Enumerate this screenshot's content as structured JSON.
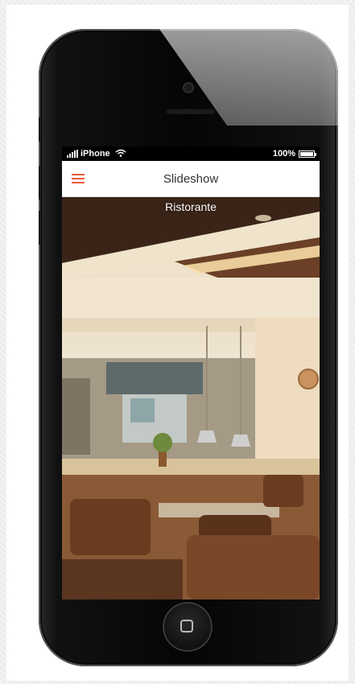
{
  "status_bar": {
    "carrier": "iPhone",
    "battery_percent": "100%",
    "battery_level": 1.0,
    "signal_icon": "signal-bars-icon",
    "wifi_icon": "wifi-icon"
  },
  "header": {
    "title": "Slideshow",
    "menu_icon": "hamburger-menu-icon",
    "accent_color": "#e85c3a"
  },
  "slideshow": {
    "caption": "Ristorante",
    "image_subject": "restaurant interior with open kitchen"
  }
}
